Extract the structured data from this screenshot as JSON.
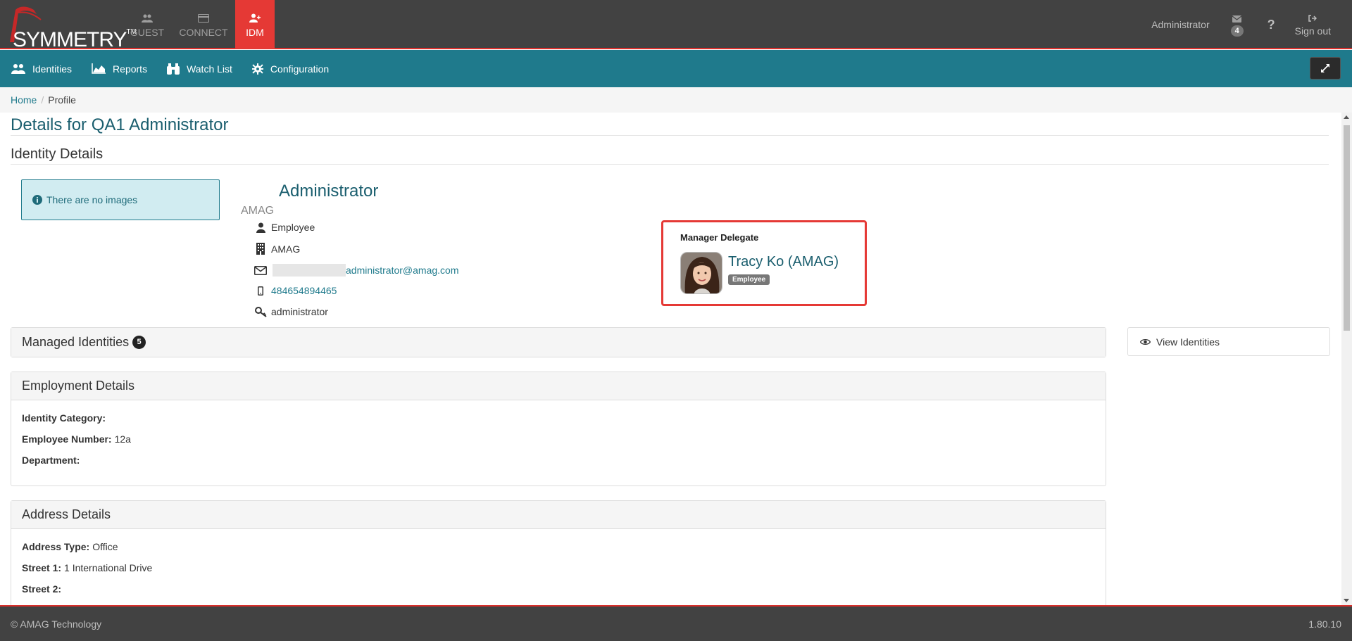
{
  "brand": {
    "name": "SYMMETRY",
    "tm": "TM"
  },
  "topnav": [
    {
      "label": "GUEST",
      "icon": "users-icon"
    },
    {
      "label": "CONNECT",
      "icon": "card-icon"
    },
    {
      "label": "IDM",
      "icon": "user-plus-icon",
      "active": true
    }
  ],
  "user": {
    "name": "Administrator",
    "mail_count": "4",
    "help": "?",
    "signout": "Sign out"
  },
  "subnav": [
    {
      "label": "Identities",
      "icon": "users-icon"
    },
    {
      "label": "Reports",
      "icon": "area-chart-icon"
    },
    {
      "label": "Watch List",
      "icon": "binoculars-icon"
    },
    {
      "label": "Configuration",
      "icon": "gear-icon"
    }
  ],
  "breadcrumb": {
    "home": "Home",
    "separator": "/",
    "current": "Profile"
  },
  "page": {
    "title": "Details for QA1 Administrator",
    "section": "Identity Details",
    "no_images": "There are no images"
  },
  "identity": {
    "name": "Administrator",
    "company": "AMAG",
    "type": "Employee",
    "organization": "AMAG",
    "email": "administrator@amag.com",
    "phone": "484654894465",
    "login": "administrator"
  },
  "manager_delegate": {
    "title": "Manager Delegate",
    "name": "Tracy Ko (AMAG)",
    "badge": "Employee"
  },
  "managed_identities": {
    "title": "Managed Identities",
    "count": "5",
    "button": "View Identities"
  },
  "employment": {
    "title": "Employment Details",
    "identity_category_label": "Identity Category:",
    "identity_category_value": "",
    "employee_number_label": "Employee Number:",
    "employee_number_value": "12a",
    "department_label": "Department:",
    "department_value": ""
  },
  "address": {
    "title": "Address Details",
    "type_label": "Address Type:",
    "type_value": "Office",
    "street1_label": "Street 1:",
    "street1_value": "1 International Drive",
    "street2_label": "Street 2:",
    "street2_value": ""
  },
  "footer": {
    "copyright": "© AMAG Technology",
    "version": "1.80.10"
  },
  "colors": {
    "topbar": "#424242",
    "accent_red": "#e53935",
    "teal": "#1f7a8c",
    "link": "#1a5e6e"
  }
}
